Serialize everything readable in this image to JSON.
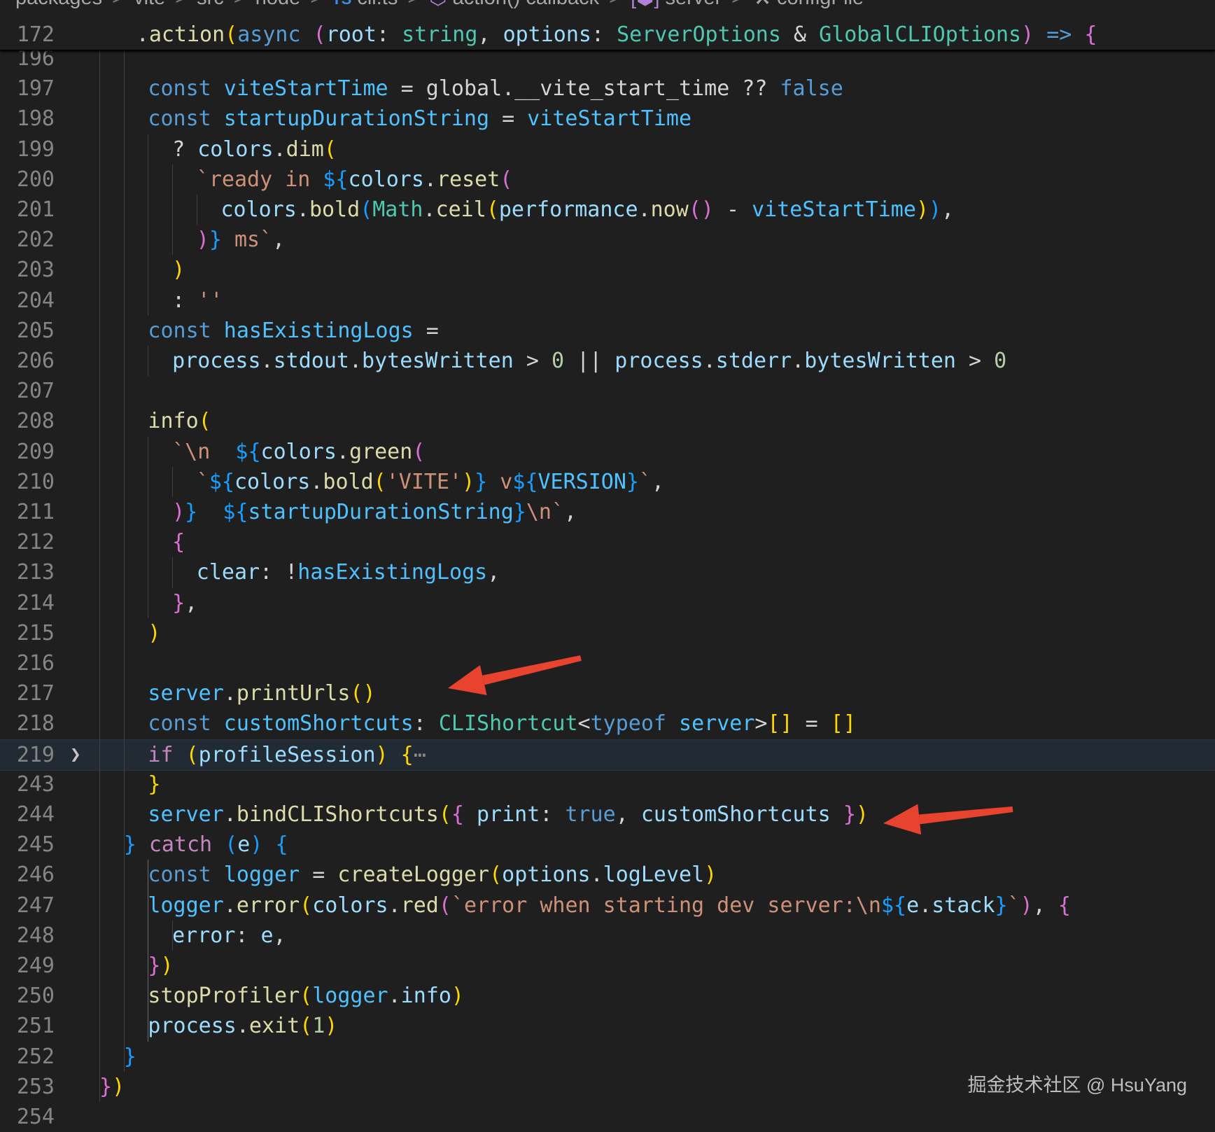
{
  "breadcrumb": {
    "items": [
      {
        "icon": "",
        "label": "packages"
      },
      {
        "icon": "",
        "label": "vite"
      },
      {
        "icon": "",
        "label": "src"
      },
      {
        "icon": "",
        "label": "node"
      },
      {
        "icon": "TS",
        "label": "cli.ts"
      },
      {
        "icon": "cube-icon",
        "label": "action() callback"
      },
      {
        "icon": "variable-icon",
        "label": "server"
      },
      {
        "icon": "wrench-icon",
        "label": "configFile"
      }
    ],
    "separator": ">"
  },
  "sticky_header": {
    "line_number": "172",
    "tokens": [
      [
        " ",
        "pun"
      ],
      [
        ".",
        "pun"
      ],
      [
        "action",
        "fn"
      ],
      [
        "(",
        "b1"
      ],
      [
        "async",
        "kw"
      ],
      [
        " ",
        "pun"
      ],
      [
        "(",
        "b2"
      ],
      [
        "root",
        "var"
      ],
      [
        ": ",
        "pun"
      ],
      [
        "string",
        "typ"
      ],
      [
        ", ",
        "pun"
      ],
      [
        "options",
        "var"
      ],
      [
        ": ",
        "pun"
      ],
      [
        "ServerOptions",
        "typ"
      ],
      [
        " & ",
        "pun"
      ],
      [
        "GlobalCLIOptions",
        "typ"
      ],
      [
        ")",
        "b2"
      ],
      [
        " ",
        "pun"
      ],
      [
        "=>",
        "kw"
      ],
      [
        " ",
        "pun"
      ],
      [
        "{",
        "b2"
      ]
    ]
  },
  "lines": [
    {
      "n": "196",
      "tokens": []
    },
    {
      "n": "197",
      "tokens": [
        [
          "const",
          "kw"
        ],
        [
          " ",
          "pun"
        ],
        [
          "viteStartTime",
          "cst"
        ],
        [
          " = ",
          "pun"
        ],
        [
          "global",
          "pun"
        ],
        [
          ".",
          "pun"
        ],
        [
          "__vite_start_time",
          "pun"
        ],
        [
          " ?? ",
          "pun"
        ],
        [
          "false",
          "kw"
        ]
      ]
    },
    {
      "n": "198",
      "tokens": [
        [
          "const",
          "kw"
        ],
        [
          " ",
          "pun"
        ],
        [
          "startupDurationString",
          "cst"
        ],
        [
          " = ",
          "pun"
        ],
        [
          "viteStartTime",
          "cst"
        ]
      ]
    },
    {
      "n": "199",
      "tokens": [
        [
          "? ",
          "pun"
        ],
        [
          "colors",
          "var"
        ],
        [
          ".",
          "pun"
        ],
        [
          "dim",
          "fn"
        ],
        [
          "(",
          "b1"
        ]
      ]
    },
    {
      "n": "200",
      "tokens": [
        [
          "`ready in ",
          "str"
        ],
        [
          "${",
          "b3"
        ],
        [
          "colors",
          "var"
        ],
        [
          ".",
          "pun"
        ],
        [
          "reset",
          "fn"
        ],
        [
          "(",
          "b2"
        ]
      ]
    },
    {
      "n": "201",
      "tokens": [
        [
          "colors",
          "var"
        ],
        [
          ".",
          "pun"
        ],
        [
          "bold",
          "fn"
        ],
        [
          "(",
          "b3"
        ],
        [
          "Math",
          "typ"
        ],
        [
          ".",
          "pun"
        ],
        [
          "ceil",
          "fn"
        ],
        [
          "(",
          "b1"
        ],
        [
          "performance",
          "var"
        ],
        [
          ".",
          "pun"
        ],
        [
          "now",
          "fn"
        ],
        [
          "()",
          "b2"
        ],
        [
          " - ",
          "pun"
        ],
        [
          "viteStartTime",
          "cst"
        ],
        [
          ")",
          "b1"
        ],
        [
          ")",
          "b3"
        ],
        [
          ",",
          "pun"
        ]
      ]
    },
    {
      "n": "202",
      "tokens": [
        [
          ")",
          "b2"
        ],
        [
          "}",
          "b3"
        ],
        [
          " ms`",
          "str"
        ],
        [
          ",",
          "pun"
        ]
      ]
    },
    {
      "n": "203",
      "tokens": [
        [
          ")",
          "b1"
        ]
      ]
    },
    {
      "n": "204",
      "tokens": [
        [
          ": ",
          "pun"
        ],
        [
          "''",
          "str"
        ]
      ]
    },
    {
      "n": "205",
      "tokens": [
        [
          "const",
          "kw"
        ],
        [
          " ",
          "pun"
        ],
        [
          "hasExistingLogs",
          "cst"
        ],
        [
          " =",
          "pun"
        ]
      ]
    },
    {
      "n": "206",
      "tokens": [
        [
          "process",
          "var"
        ],
        [
          ".",
          "pun"
        ],
        [
          "stdout",
          "var"
        ],
        [
          ".",
          "pun"
        ],
        [
          "bytesWritten",
          "var"
        ],
        [
          " > ",
          "pun"
        ],
        [
          "0",
          "num"
        ],
        [
          " || ",
          "pun"
        ],
        [
          "process",
          "var"
        ],
        [
          ".",
          "pun"
        ],
        [
          "stderr",
          "var"
        ],
        [
          ".",
          "pun"
        ],
        [
          "bytesWritten",
          "var"
        ],
        [
          " > ",
          "pun"
        ],
        [
          "0",
          "num"
        ]
      ]
    },
    {
      "n": "207",
      "tokens": []
    },
    {
      "n": "208",
      "tokens": [
        [
          "info",
          "fn"
        ],
        [
          "(",
          "b1"
        ]
      ]
    },
    {
      "n": "209",
      "tokens": [
        [
          "`\\n  ",
          "str"
        ],
        [
          "${",
          "b3"
        ],
        [
          "colors",
          "var"
        ],
        [
          ".",
          "pun"
        ],
        [
          "green",
          "fn"
        ],
        [
          "(",
          "b2"
        ]
      ]
    },
    {
      "n": "210",
      "tokens": [
        [
          "`",
          "str"
        ],
        [
          "${",
          "b3"
        ],
        [
          "colors",
          "var"
        ],
        [
          ".",
          "pun"
        ],
        [
          "bold",
          "fn"
        ],
        [
          "(",
          "b1"
        ],
        [
          "'VITE'",
          "str"
        ],
        [
          ")",
          "b1"
        ],
        [
          "}",
          "b3"
        ],
        [
          " v",
          "str"
        ],
        [
          "${",
          "b3"
        ],
        [
          "VERSION",
          "cst"
        ],
        [
          "}",
          "b3"
        ],
        [
          "`",
          "str"
        ],
        [
          ",",
          "pun"
        ]
      ]
    },
    {
      "n": "211",
      "tokens": [
        [
          ")",
          "b2"
        ],
        [
          "}",
          "b3"
        ],
        [
          "  ",
          "str"
        ],
        [
          "${",
          "b3"
        ],
        [
          "startupDurationString",
          "cst"
        ],
        [
          "}",
          "b3"
        ],
        [
          "\\n`",
          "str"
        ],
        [
          ",",
          "pun"
        ]
      ]
    },
    {
      "n": "212",
      "tokens": [
        [
          "{",
          "b2"
        ]
      ]
    },
    {
      "n": "213",
      "tokens": [
        [
          "clear",
          "var"
        ],
        [
          ": !",
          "pun"
        ],
        [
          "hasExistingLogs",
          "cst"
        ],
        [
          ",",
          "pun"
        ]
      ]
    },
    {
      "n": "214",
      "tokens": [
        [
          "}",
          "b2"
        ],
        [
          ",",
          "pun"
        ]
      ]
    },
    {
      "n": "215",
      "tokens": [
        [
          ")",
          "b1"
        ]
      ]
    },
    {
      "n": "216",
      "tokens": []
    },
    {
      "n": "217",
      "tokens": [
        [
          "server",
          "cst"
        ],
        [
          ".",
          "pun"
        ],
        [
          "printUrls",
          "fn"
        ],
        [
          "()",
          "b1"
        ]
      ]
    },
    {
      "n": "218",
      "tokens": [
        [
          "const",
          "kw"
        ],
        [
          " ",
          "pun"
        ],
        [
          "customShortcuts",
          "cst"
        ],
        [
          ": ",
          "pun"
        ],
        [
          "CLIShortcut",
          "typ"
        ],
        [
          "<",
          "pun"
        ],
        [
          "typeof",
          "kw"
        ],
        [
          " ",
          "pun"
        ],
        [
          "server",
          "cst"
        ],
        [
          ">",
          "pun"
        ],
        [
          "[]",
          "b1"
        ],
        [
          " = ",
          "pun"
        ],
        [
          "[]",
          "b1"
        ]
      ]
    },
    {
      "n": "219",
      "fold": true,
      "tokens": [
        [
          "if",
          "ctl"
        ],
        [
          " ",
          "pun"
        ],
        [
          "(",
          "b1"
        ],
        [
          "profileSession",
          "var"
        ],
        [
          ")",
          "b1"
        ],
        [
          " ",
          "pun"
        ],
        [
          "{",
          "b1"
        ],
        [
          "⋯",
          "fold-dots"
        ]
      ]
    },
    {
      "n": "243",
      "tokens": [
        [
          "}",
          "b1"
        ]
      ]
    },
    {
      "n": "244",
      "tokens": [
        [
          "server",
          "cst"
        ],
        [
          ".",
          "pun"
        ],
        [
          "bindCLIShortcuts",
          "fn"
        ],
        [
          "(",
          "b1"
        ],
        [
          "{",
          "b2"
        ],
        [
          " ",
          "pun"
        ],
        [
          "print",
          "var"
        ],
        [
          ": ",
          "pun"
        ],
        [
          "true",
          "kw"
        ],
        [
          ", ",
          "pun"
        ],
        [
          "customShortcuts",
          "var"
        ],
        [
          " ",
          "pun"
        ],
        [
          "}",
          "b2"
        ],
        [
          ")",
          "b1"
        ]
      ]
    },
    {
      "n": "245",
      "tokens": [
        [
          "}",
          "b3"
        ],
        [
          " ",
          "pun"
        ],
        [
          "catch",
          "ctl"
        ],
        [
          " ",
          "pun"
        ],
        [
          "(",
          "b3"
        ],
        [
          "e",
          "var"
        ],
        [
          ")",
          "b3"
        ],
        [
          " ",
          "pun"
        ],
        [
          "{",
          "b3"
        ]
      ]
    },
    {
      "n": "246",
      "tokens": [
        [
          "const",
          "kw"
        ],
        [
          " ",
          "pun"
        ],
        [
          "logger",
          "cst"
        ],
        [
          " = ",
          "pun"
        ],
        [
          "createLogger",
          "fn"
        ],
        [
          "(",
          "b1"
        ],
        [
          "options",
          "var"
        ],
        [
          ".",
          "pun"
        ],
        [
          "logLevel",
          "var"
        ],
        [
          ")",
          "b1"
        ]
      ]
    },
    {
      "n": "247",
      "tokens": [
        [
          "logger",
          "cst"
        ],
        [
          ".",
          "pun"
        ],
        [
          "error",
          "fn"
        ],
        [
          "(",
          "b1"
        ],
        [
          "colors",
          "var"
        ],
        [
          ".",
          "pun"
        ],
        [
          "red",
          "fn"
        ],
        [
          "(",
          "b2"
        ],
        [
          "`error when starting dev server:\\n",
          "str"
        ],
        [
          "${",
          "b3"
        ],
        [
          "e",
          "var"
        ],
        [
          ".",
          "pun"
        ],
        [
          "stack",
          "var"
        ],
        [
          "}",
          "b3"
        ],
        [
          "`",
          "str"
        ],
        [
          ")",
          "b2"
        ],
        [
          ", ",
          "pun"
        ],
        [
          "{",
          "b2"
        ]
      ]
    },
    {
      "n": "248",
      "tokens": [
        [
          "error",
          "var"
        ],
        [
          ": ",
          "pun"
        ],
        [
          "e",
          "var"
        ],
        [
          ",",
          "pun"
        ]
      ]
    },
    {
      "n": "249",
      "tokens": [
        [
          "}",
          "b2"
        ],
        [
          ")",
          "b1"
        ]
      ]
    },
    {
      "n": "250",
      "tokens": [
        [
          "stopProfiler",
          "fn"
        ],
        [
          "(",
          "b1"
        ],
        [
          "logger",
          "cst"
        ],
        [
          ".",
          "pun"
        ],
        [
          "info",
          "var"
        ],
        [
          ")",
          "b1"
        ]
      ]
    },
    {
      "n": "251",
      "tokens": [
        [
          "process",
          "var"
        ],
        [
          ".",
          "pun"
        ],
        [
          "exit",
          "fn"
        ],
        [
          "(",
          "b1"
        ],
        [
          "1",
          "num"
        ],
        [
          ")",
          "b1"
        ]
      ]
    },
    {
      "n": "252",
      "tokens": [
        [
          "}",
          "b3"
        ]
      ]
    },
    {
      "n": "253",
      "tokens": [
        [
          "}",
          "b2"
        ],
        [
          ")",
          "b1"
        ]
      ]
    },
    {
      "n": "254",
      "tokens": []
    }
  ],
  "watermark": "掘金技术社区 @ HsuYang",
  "annotation_color": "#e8432e",
  "editor_background": "#1f1f1f"
}
